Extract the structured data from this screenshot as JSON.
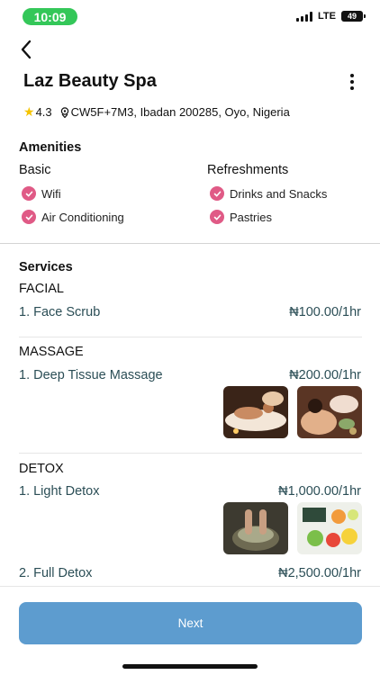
{
  "status_bar": {
    "time": "10:09",
    "network": "LTE",
    "battery": "49"
  },
  "header": {
    "back_icon": "chevron-left-icon",
    "title": "Laz Beauty Spa",
    "more_icon": "kebab-menu-icon"
  },
  "info": {
    "rating": "4.3",
    "address": "CW5F+7M3, Ibadan 200285, Oyo, Nigeria",
    "star_color": "#f5c400"
  },
  "amenities": {
    "heading": "Amenities",
    "groups": [
      {
        "title": "Basic",
        "items": [
          "Wifi",
          "Air Conditioning"
        ]
      },
      {
        "title": "Refreshments",
        "items": [
          "Drinks and Snacks",
          "Pastries"
        ]
      }
    ],
    "check_color": "#e05a86"
  },
  "services": {
    "heading": "Services",
    "categories": [
      {
        "name": "FACIAL",
        "items": [
          {
            "name": "1. Face Scrub",
            "price": "₦100.00/1hr"
          }
        ]
      },
      {
        "name": "MASSAGE",
        "items": [
          {
            "name": "1. Deep Tissue Massage",
            "price": "₦200.00/1hr",
            "images": [
              "massage-photo-1",
              "massage-photo-2"
            ]
          }
        ]
      },
      {
        "name": "DETOX",
        "items": [
          {
            "name": "1. Light Detox",
            "price": "₦1,000.00/1hr",
            "images": [
              "foot-detox-photo",
              "detox-fruits-photo"
            ]
          },
          {
            "name": "2. Full Detox",
            "price": "₦2,500.00/1hr"
          }
        ]
      }
    ],
    "text_color": "#2b4e56"
  },
  "footer": {
    "next_label": "Next",
    "button_color": "#5d9ccf"
  }
}
